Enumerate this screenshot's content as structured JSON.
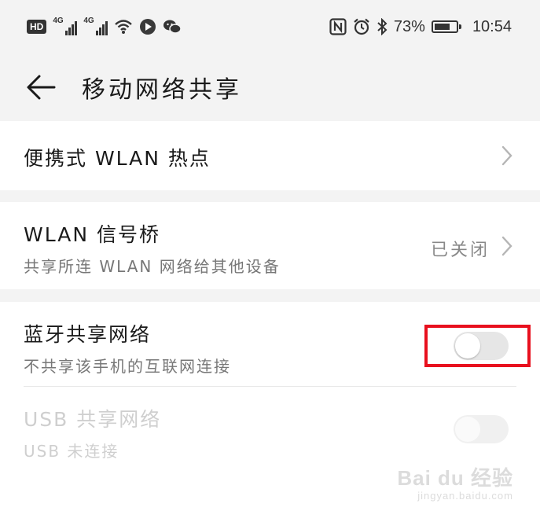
{
  "status_bar": {
    "hd_badge": "HD",
    "signal_1_label": "4G",
    "signal_2_label": "4G",
    "icons_left": [
      "wifi-icon",
      "app-icon",
      "wechat-icon"
    ],
    "icons_right": [
      "nfc-icon",
      "alarm-icon",
      "bluetooth-icon"
    ],
    "battery_percent": "73%",
    "battery_level": 73,
    "time": "10:54"
  },
  "header": {
    "back_icon": "arrow-left-icon",
    "title": "移动网络共享"
  },
  "items": [
    {
      "title": "便携式 WLAN 热点",
      "control": "chevron"
    },
    {
      "title": "WLAN 信号桥",
      "subtitle": "共享所连 WLAN 网络给其他设备",
      "status": "已关闭",
      "control": "chevron"
    },
    {
      "title": "蓝牙共享网络",
      "subtitle": "不共享该手机的互联网连接",
      "control": "toggle",
      "toggle_on": false,
      "highlighted": true
    },
    {
      "title": "USB 共享网络",
      "subtitle": "USB 未连接",
      "control": "toggle",
      "toggle_on": false,
      "disabled": true
    }
  ],
  "watermark": {
    "main": "Bai du 经验",
    "sub": "jingyan.baidu.com"
  },
  "colors": {
    "highlight_border": "#e8101e",
    "page_background": "#f3f3f3",
    "card_background": "#ffffff"
  }
}
